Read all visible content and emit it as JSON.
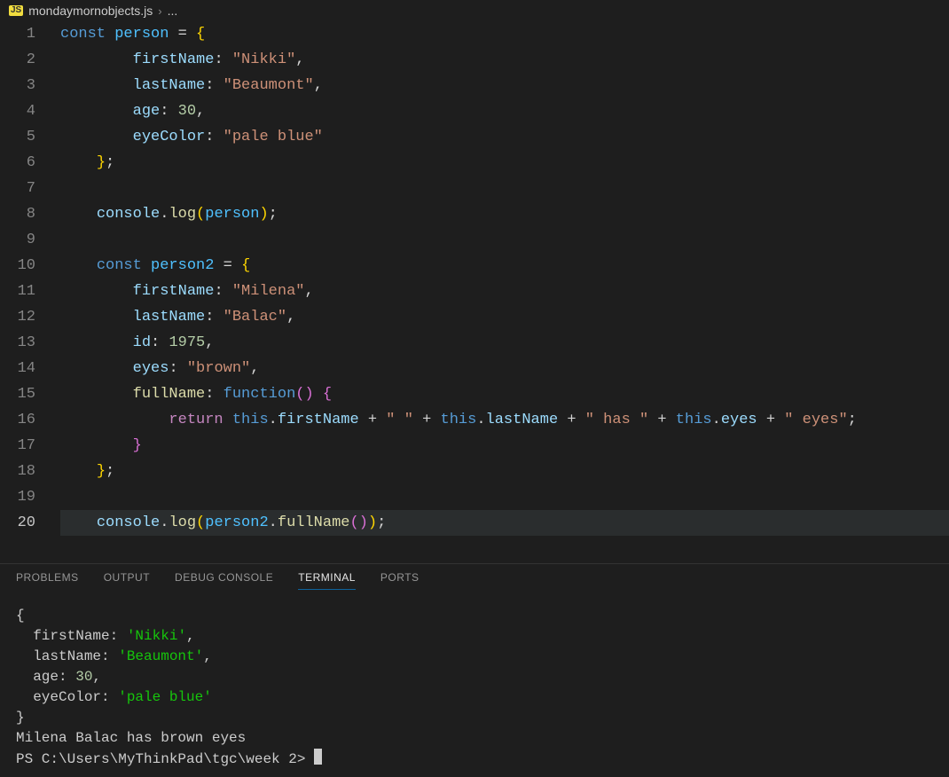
{
  "breadcrumb": {
    "icon": "JS",
    "file": "mondaymornobjects.js",
    "separator": "›",
    "trail": "..."
  },
  "editor": {
    "activeLine": 20,
    "lines": [
      {
        "n": 1,
        "tokens": [
          [
            "kw",
            "const"
          ],
          [
            "pn",
            " "
          ],
          [
            "var",
            "person"
          ],
          [
            "pn",
            " "
          ],
          [
            "pn",
            "="
          ],
          [
            "pn",
            " "
          ],
          [
            "br1",
            "{"
          ]
        ]
      },
      {
        "n": 2,
        "indent": 2,
        "tokens": [
          [
            "prop",
            "firstName"
          ],
          [
            "pn",
            ":"
          ],
          [
            "pn",
            " "
          ],
          [
            "str",
            "\"Nikki\""
          ],
          [
            "pn",
            ","
          ]
        ]
      },
      {
        "n": 3,
        "indent": 2,
        "tokens": [
          [
            "prop",
            "lastName"
          ],
          [
            "pn",
            ":"
          ],
          [
            "pn",
            " "
          ],
          [
            "str",
            "\"Beaumont\""
          ],
          [
            "pn",
            ","
          ]
        ]
      },
      {
        "n": 4,
        "indent": 2,
        "tokens": [
          [
            "prop",
            "age"
          ],
          [
            "pn",
            ":"
          ],
          [
            "pn",
            " "
          ],
          [
            "num",
            "30"
          ],
          [
            "pn",
            ","
          ]
        ]
      },
      {
        "n": 5,
        "indent": 2,
        "tokens": [
          [
            "prop",
            "eyeColor"
          ],
          [
            "pn",
            ":"
          ],
          [
            "pn",
            " "
          ],
          [
            "str",
            "\"pale blue\""
          ]
        ]
      },
      {
        "n": 6,
        "indent": 1,
        "tokens": [
          [
            "br1",
            "}"
          ],
          [
            "pn",
            ";"
          ]
        ]
      },
      {
        "n": 7,
        "tokens": []
      },
      {
        "n": 8,
        "indent": 1,
        "tokens": [
          [
            "obj",
            "console"
          ],
          [
            "pn",
            "."
          ],
          [
            "func",
            "log"
          ],
          [
            "br1",
            "("
          ],
          [
            "var",
            "person"
          ],
          [
            "br1",
            ")"
          ],
          [
            "pn",
            ";"
          ]
        ]
      },
      {
        "n": 9,
        "tokens": []
      },
      {
        "n": 10,
        "indent": 1,
        "tokens": [
          [
            "kw",
            "const"
          ],
          [
            "pn",
            " "
          ],
          [
            "var",
            "person2"
          ],
          [
            "pn",
            " "
          ],
          [
            "pn",
            "="
          ],
          [
            "pn",
            " "
          ],
          [
            "br1",
            "{"
          ]
        ]
      },
      {
        "n": 11,
        "indent": 2,
        "tokens": [
          [
            "prop",
            "firstName"
          ],
          [
            "pn",
            ":"
          ],
          [
            "pn",
            " "
          ],
          [
            "str",
            "\"Milena\""
          ],
          [
            "pn",
            ","
          ]
        ]
      },
      {
        "n": 12,
        "indent": 2,
        "tokens": [
          [
            "prop",
            "lastName"
          ],
          [
            "pn",
            ":"
          ],
          [
            "pn",
            " "
          ],
          [
            "str",
            "\"Balac\""
          ],
          [
            "pn",
            ","
          ]
        ]
      },
      {
        "n": 13,
        "indent": 2,
        "tokens": [
          [
            "prop",
            "id"
          ],
          [
            "pn",
            ":"
          ],
          [
            "pn",
            " "
          ],
          [
            "num",
            "1975"
          ],
          [
            "pn",
            ","
          ]
        ]
      },
      {
        "n": 14,
        "indent": 2,
        "tokens": [
          [
            "prop",
            "eyes"
          ],
          [
            "pn",
            ":"
          ],
          [
            "pn",
            " "
          ],
          [
            "str",
            "\"brown\""
          ],
          [
            "pn",
            ","
          ]
        ]
      },
      {
        "n": 15,
        "indent": 2,
        "tokens": [
          [
            "func",
            "fullName"
          ],
          [
            "pn",
            ":"
          ],
          [
            "pn",
            " "
          ],
          [
            "kw",
            "function"
          ],
          [
            "br2",
            "("
          ],
          [
            "br2",
            ")"
          ],
          [
            "pn",
            " "
          ],
          [
            "br2",
            "{"
          ]
        ]
      },
      {
        "n": 16,
        "indent": 3,
        "tokens": [
          [
            "kw2",
            "return"
          ],
          [
            "pn",
            " "
          ],
          [
            "this",
            "this"
          ],
          [
            "pn",
            "."
          ],
          [
            "prop",
            "firstName"
          ],
          [
            "pn",
            " "
          ],
          [
            "pn",
            "+"
          ],
          [
            "pn",
            " "
          ],
          [
            "str",
            "\" \""
          ],
          [
            "pn",
            " "
          ],
          [
            "pn",
            "+"
          ],
          [
            "pn",
            " "
          ],
          [
            "this",
            "this"
          ],
          [
            "pn",
            "."
          ],
          [
            "prop",
            "lastName"
          ],
          [
            "pn",
            " "
          ],
          [
            "pn",
            "+"
          ],
          [
            "pn",
            " "
          ],
          [
            "str",
            "\" has \""
          ],
          [
            "pn",
            " "
          ],
          [
            "pn",
            "+"
          ],
          [
            "pn",
            " "
          ],
          [
            "this",
            "this"
          ],
          [
            "pn",
            "."
          ],
          [
            "prop",
            "eyes"
          ],
          [
            "pn",
            " "
          ],
          [
            "pn",
            "+"
          ],
          [
            "pn",
            " "
          ],
          [
            "str",
            "\" eyes\""
          ],
          [
            "pn",
            ";"
          ]
        ]
      },
      {
        "n": 17,
        "indent": 2,
        "tokens": [
          [
            "br2",
            "}"
          ]
        ]
      },
      {
        "n": 18,
        "indent": 1,
        "tokens": [
          [
            "br1",
            "}"
          ],
          [
            "pn",
            ";"
          ]
        ]
      },
      {
        "n": 19,
        "tokens": []
      },
      {
        "n": 20,
        "indent": 1,
        "tokens": [
          [
            "obj",
            "console"
          ],
          [
            "pn",
            "."
          ],
          [
            "func",
            "log"
          ],
          [
            "br1",
            "("
          ],
          [
            "var",
            "person2"
          ],
          [
            "pn",
            "."
          ],
          [
            "func",
            "fullName"
          ],
          [
            "br2",
            "("
          ],
          [
            "br2",
            ")"
          ],
          [
            "br1",
            ")"
          ],
          [
            "pn",
            ";"
          ]
        ]
      }
    ]
  },
  "panel": {
    "tabs": [
      "PROBLEMS",
      "OUTPUT",
      "DEBUG CONSOLE",
      "TERMINAL",
      "PORTS"
    ],
    "activeTab": "TERMINAL"
  },
  "terminal": {
    "lines": [
      {
        "tokens": [
          [
            "pn",
            "{"
          ]
        ]
      },
      {
        "tokens": [
          [
            "pn",
            "  "
          ],
          [
            "prop",
            "firstName"
          ],
          [
            "pn",
            ": "
          ],
          [
            "str",
            "'Nikki'"
          ],
          [
            "pn",
            ","
          ]
        ]
      },
      {
        "tokens": [
          [
            "pn",
            "  "
          ],
          [
            "prop",
            "lastName"
          ],
          [
            "pn",
            ": "
          ],
          [
            "str",
            "'Beaumont'"
          ],
          [
            "pn",
            ","
          ]
        ]
      },
      {
        "tokens": [
          [
            "pn",
            "  "
          ],
          [
            "prop",
            "age"
          ],
          [
            "pn",
            ": "
          ],
          [
            "num",
            "30"
          ],
          [
            "pn",
            ","
          ]
        ]
      },
      {
        "tokens": [
          [
            "pn",
            "  "
          ],
          [
            "prop",
            "eyeColor"
          ],
          [
            "pn",
            ": "
          ],
          [
            "str",
            "'pale blue'"
          ]
        ]
      },
      {
        "tokens": [
          [
            "pn",
            "}"
          ]
        ]
      },
      {
        "tokens": [
          [
            "pn",
            "Milena Balac has brown eyes"
          ]
        ]
      }
    ],
    "prompt": "PS C:\\Users\\MyThinkPad\\tgc\\week 2> "
  }
}
